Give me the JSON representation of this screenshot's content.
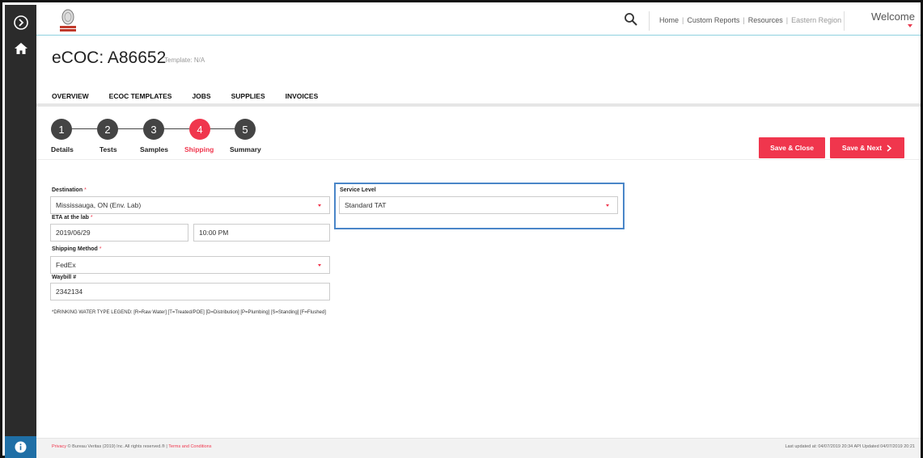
{
  "header": {
    "nav": [
      {
        "label": "Home"
      },
      {
        "label": "Custom Reports"
      },
      {
        "label": "Resources"
      },
      {
        "label": "Eastern Region"
      }
    ],
    "welcome": "Welcome"
  },
  "page": {
    "title": "eCOC: A86652",
    "template_label": "Template: N/A"
  },
  "tabs": [
    "OVERVIEW",
    "ECOC TEMPLATES",
    "JOBS",
    "SUPPLIES",
    "INVOICES"
  ],
  "stepper": {
    "steps": [
      {
        "number": "1",
        "label": "Details"
      },
      {
        "number": "2",
        "label": "Tests"
      },
      {
        "number": "3",
        "label": "Samples"
      },
      {
        "number": "4",
        "label": "Shipping"
      },
      {
        "number": "5",
        "label": "Summary"
      }
    ],
    "active_step": 4
  },
  "actions": {
    "save_close": "Save & Close",
    "save_next": "Save & Next",
    "save_next_icon": "chevron-right-icon"
  },
  "form": {
    "destination": {
      "label": "Destination",
      "required_mark": "*",
      "value": "Mississauga, ON (Env. Lab)"
    },
    "eta": {
      "label": "ETA at the lab",
      "required_mark": "*",
      "date": "2019/06/29",
      "time": "10:00 PM"
    },
    "shipping_method": {
      "label": "Shipping Method",
      "required_mark": "*",
      "value": "FedEx"
    },
    "waybill": {
      "label": "Waybill #",
      "value": "2342134"
    },
    "service_level": {
      "label": "Service Level",
      "value": "Standard TAT"
    },
    "legend": "*DRINKING WATER TYPE LEGEND: [R=Raw Water] [T=Treated/POE] [D=Distribution] [P=Plumbing] [S=Standing] [F=Flushed]"
  },
  "footer": {
    "privacy": "Privacy",
    "copyright": " © Bureau Veritas (2019) Inc. All rights reserved.® | ",
    "terms": "Terms and Conditions",
    "updated": "Last updated at: 04/07/2019 20:34 API Updated 04/07/2019 20:21"
  },
  "colors": {
    "accent": "#f0364d",
    "rail": "#2b2b2b",
    "info": "#1f6fa6",
    "highlight_border": "#4a86c8"
  }
}
